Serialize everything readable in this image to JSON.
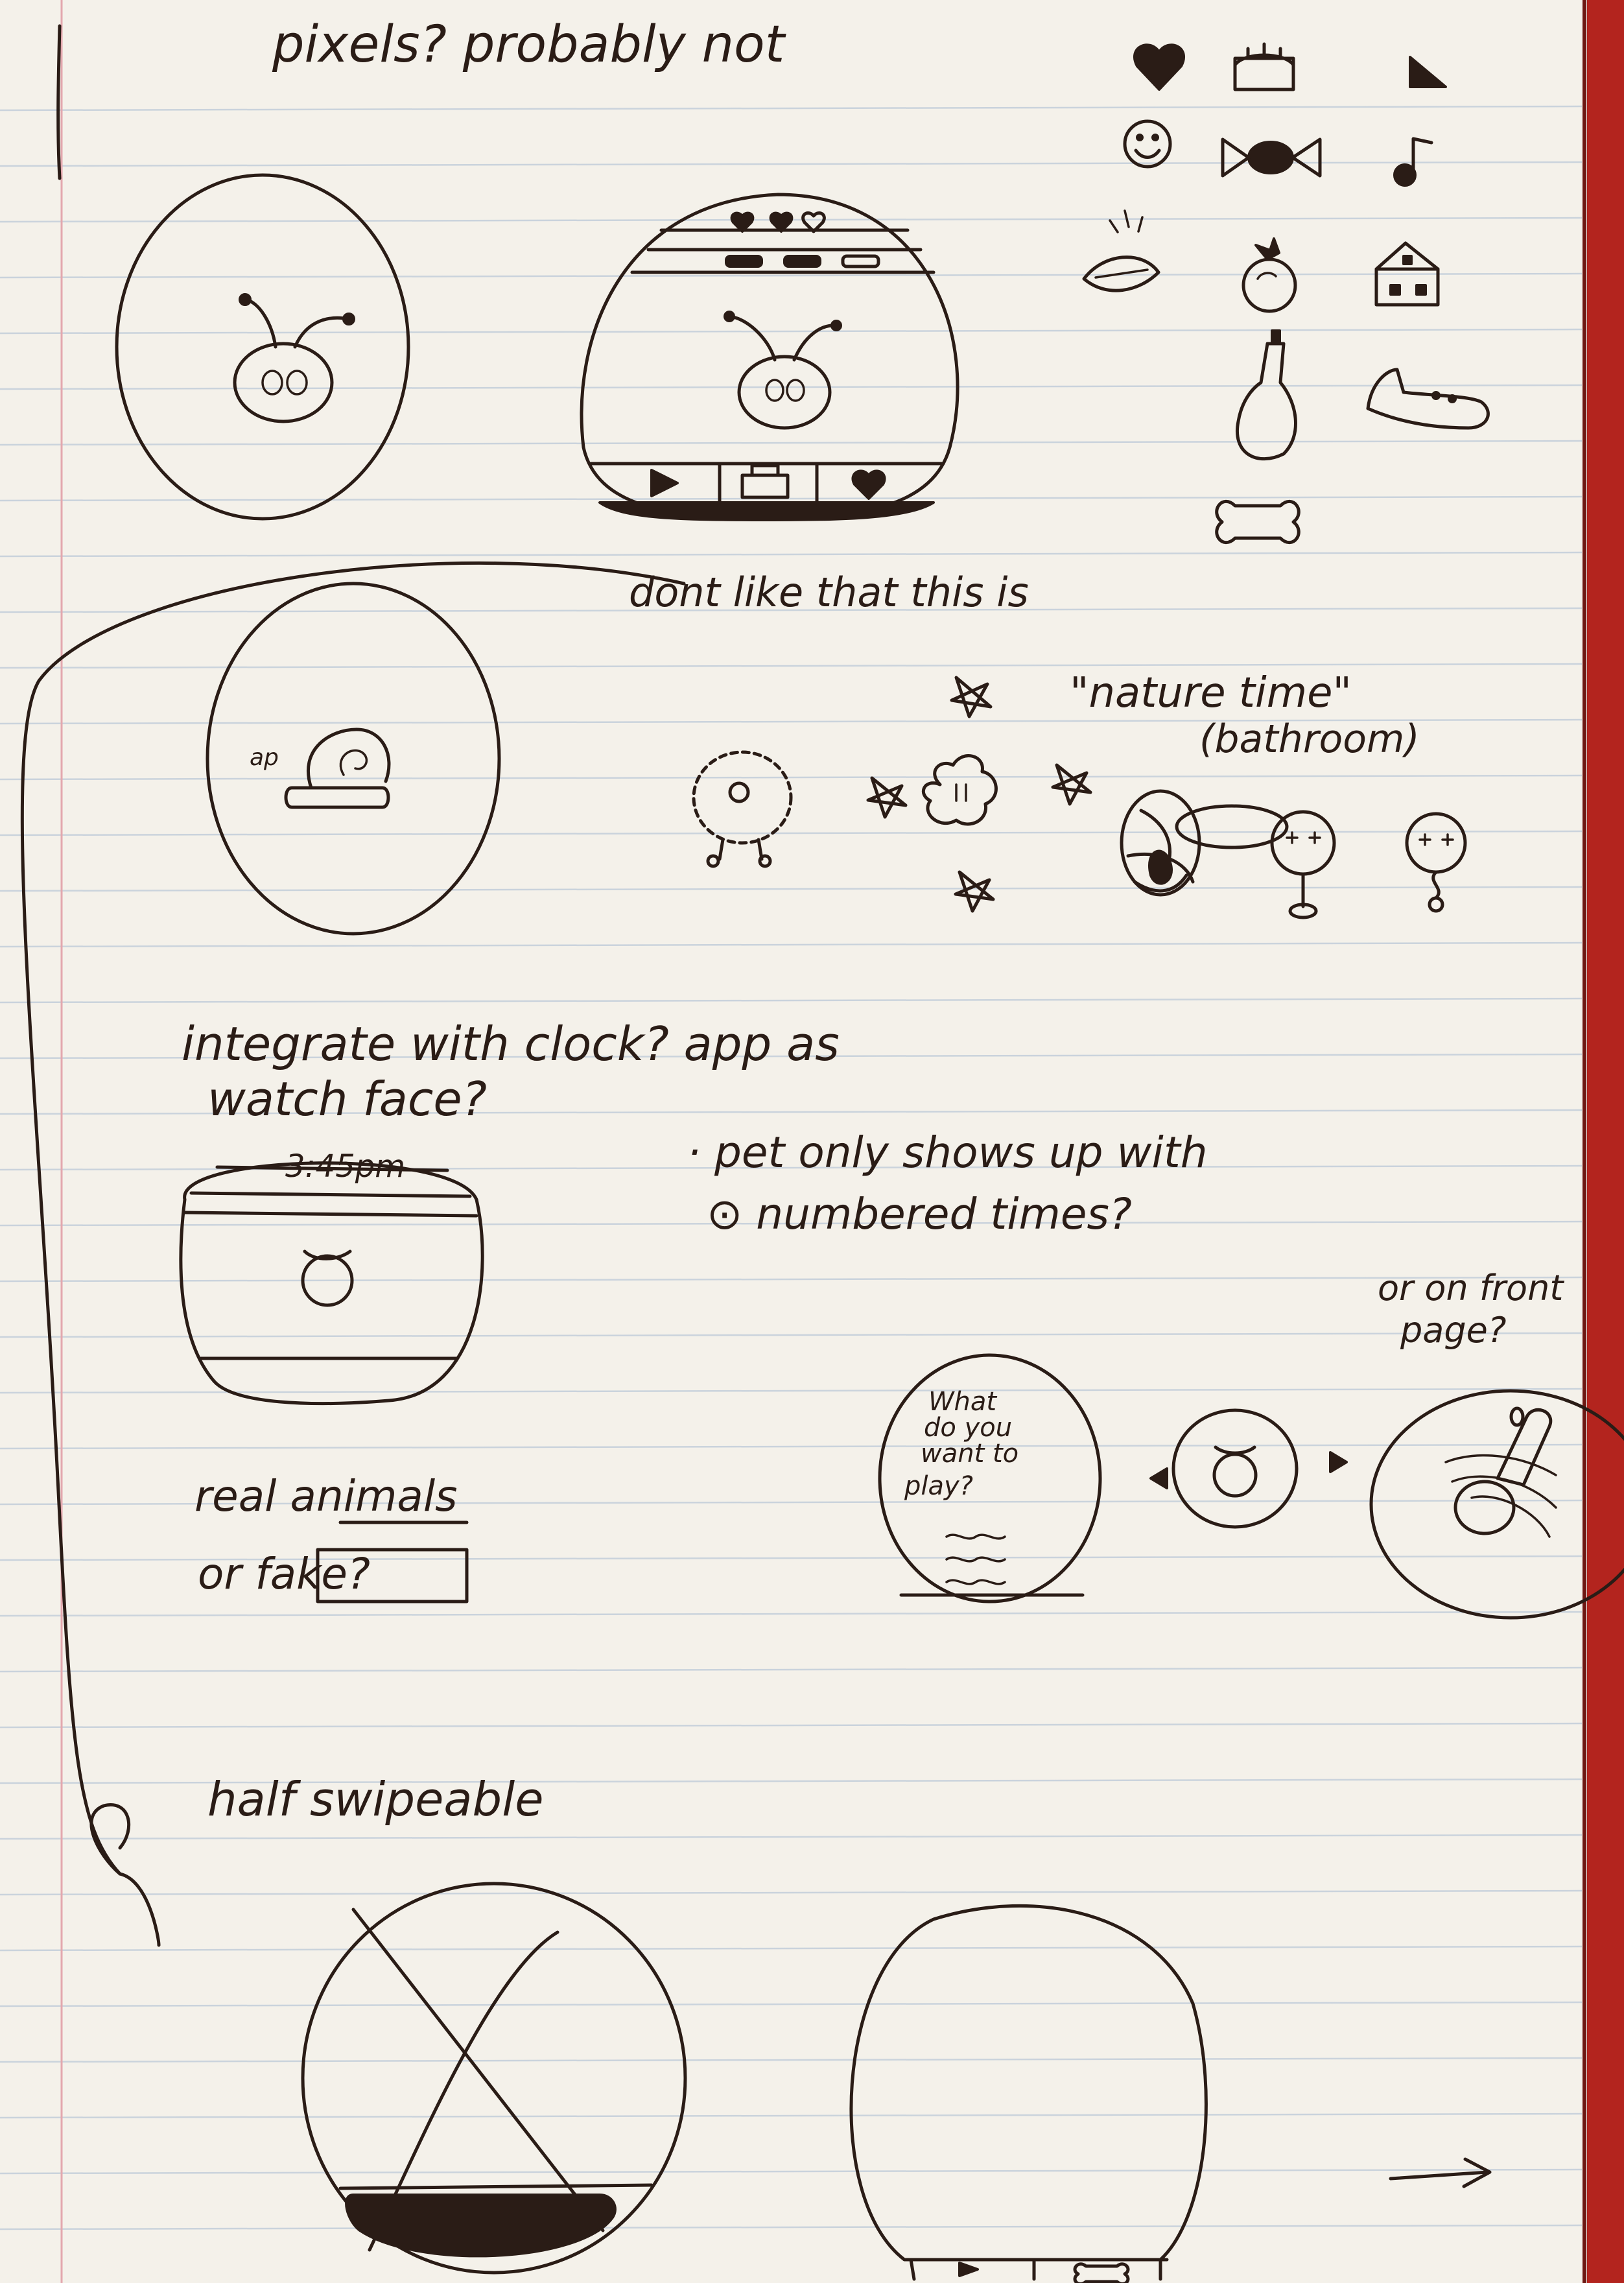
{
  "notes": {
    "pixels": "pixels? probably not",
    "dont_like": "dont like that this is",
    "nature_time": "\"nature time\"",
    "bathroom": "(bathroom)",
    "integrate_line1": "integrate with clock? app as",
    "integrate_line2": "watch face?",
    "clock_time": "3:45pm",
    "pet_only_line1": "· pet only shows up with",
    "pet_only_line2": "⊙ numbered times?",
    "real_animals": "real animals",
    "or_fake": "or fake?",
    "what_play": [
      "What",
      "do you",
      "want to",
      "play?"
    ],
    "or_front_line1": "or on front",
    "or_front_line2": "page?",
    "half_swipeable": "half swipeable"
  },
  "icons": [
    "heart-icon",
    "cake-icon",
    "play-icon",
    "smiley-icon",
    "candy-icon",
    "music-note-icon",
    "leaf-icon",
    "apple-icon",
    "house-icon",
    "bottle-icon",
    "shoe-icon",
    "bone-icon",
    "star-icon",
    "arrow-right-icon"
  ],
  "colors": {
    "paper": "#f4f1ea",
    "rule_lines": "#a9bcd2",
    "margin_line": "#e3a8ae",
    "ink": "#2a1c16",
    "binding": "#b3241e"
  }
}
